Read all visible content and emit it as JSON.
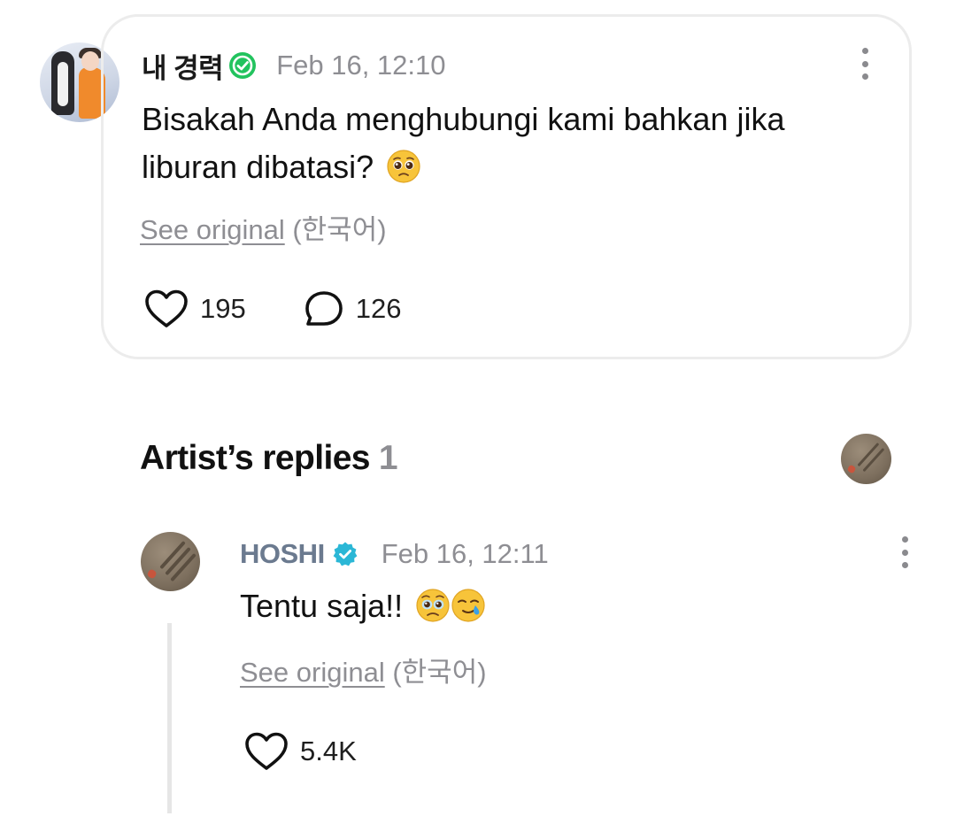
{
  "post": {
    "author": "내 경력",
    "timestamp": "Feb 16, 12:10",
    "text": "Bisakah Anda menghubungi kami bahkan jika liburan dibatasi?",
    "text_emoji": "pleading-face",
    "see_original": "See original",
    "language": "(한국어)",
    "likes": "195",
    "comments": "126",
    "badge_color": "#22c35e"
  },
  "replies": {
    "heading": "Artist’s replies",
    "count": "1",
    "items": [
      {
        "author": "HOSHI",
        "timestamp": "Feb 16, 12:11",
        "text": "Tentu saja!!",
        "text_emojis": [
          "face-holding-back-tears",
          "smiling-face-with-tear"
        ],
        "see_original": "See original",
        "language": "(한국어)",
        "likes": "5.4K",
        "badge_color": "#2bb7d6",
        "name_color": "#6b7a8f"
      }
    ]
  }
}
